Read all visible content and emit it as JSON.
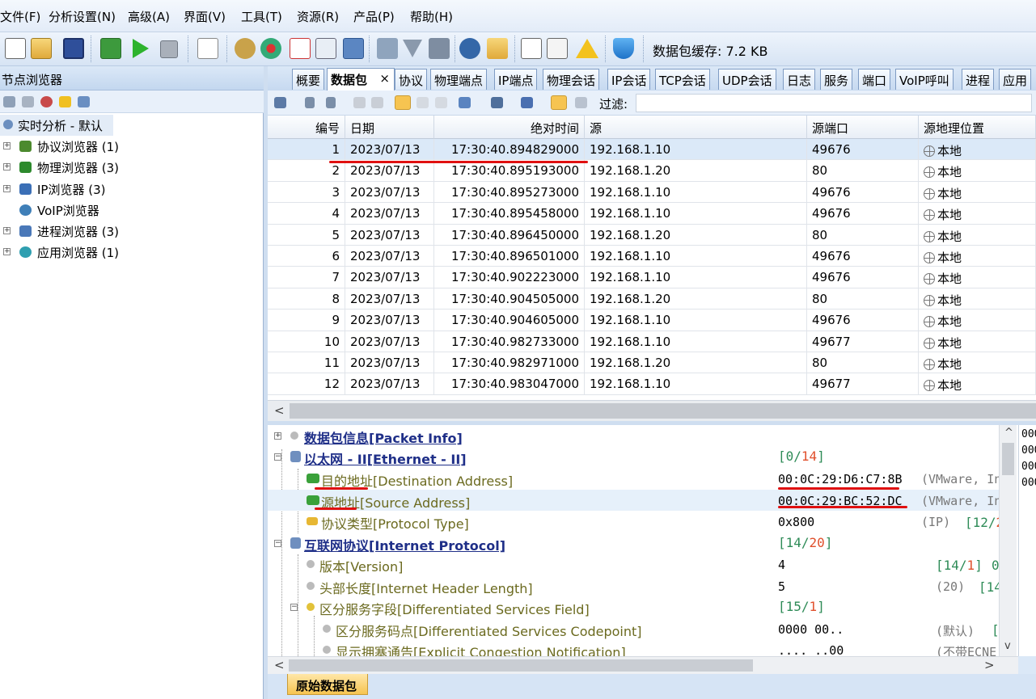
{
  "menu": [
    "文件(F)",
    "分析设置(N)",
    "高级(A)",
    "界面(V)",
    "工具(T)",
    "资源(R)",
    "产品(P)",
    "帮助(H)"
  ],
  "toolbar": {
    "buffer_label": "数据包缓存:",
    "buffer_value": "7.2 KB",
    "icons": [
      "new-icon",
      "open-icon",
      "save-icon",
      "adapter-icon",
      "play-icon",
      "stop-icon",
      "edit-icon",
      "settings-icon",
      "network-icon",
      "add-icon",
      "report-icon",
      "topology-icon",
      "trash-icon",
      "filter-icon",
      "lock-icon",
      "refresh-icon",
      "folder-icon",
      "notepad-icon",
      "copy-icon",
      "warning-icon",
      "shield-icon"
    ]
  },
  "left_panel": {
    "title": "节点浏览器",
    "root": "实时分析 - 默认",
    "items": [
      {
        "label": "协议浏览器 (1)",
        "color": "#4c8a2e"
      },
      {
        "label": "物理浏览器 (3)",
        "color": "#2d8a2d"
      },
      {
        "label": "IP浏览器 (3)",
        "color": "#3b6fb6"
      },
      {
        "label": "VoIP浏览器",
        "color": "#3f7fb8"
      },
      {
        "label": "进程浏览器 (3)",
        "color": "#4a78b8"
      },
      {
        "label": "应用浏览器 (1)",
        "color": "#2f9fb0"
      }
    ]
  },
  "tabs": {
    "items": [
      "概要",
      "数据包",
      "协议",
      "物理端点",
      "IP端点",
      "物理会话",
      "IP会话",
      "TCP会话",
      "UDP会话",
      "日志",
      "服务",
      "端口",
      "VoIP呼叫",
      "进程",
      "应用"
    ],
    "active": "数据包",
    "close": "×"
  },
  "packet_toolbar": {
    "filter_label": "过滤:"
  },
  "grid": {
    "headers": [
      "编号",
      "日期",
      "绝对时间",
      "源",
      "源端口",
      "源地理位置"
    ],
    "rows": [
      [
        "1",
        "2023/07/13",
        "17:30:40.894829000",
        "192.168.1.10",
        "49676",
        "本地"
      ],
      [
        "2",
        "2023/07/13",
        "17:30:40.895193000",
        "192.168.1.20",
        "80",
        "本地"
      ],
      [
        "3",
        "2023/07/13",
        "17:30:40.895273000",
        "192.168.1.10",
        "49676",
        "本地"
      ],
      [
        "4",
        "2023/07/13",
        "17:30:40.895458000",
        "192.168.1.10",
        "49676",
        "本地"
      ],
      [
        "5",
        "2023/07/13",
        "17:30:40.896450000",
        "192.168.1.20",
        "80",
        "本地"
      ],
      [
        "6",
        "2023/07/13",
        "17:30:40.896501000",
        "192.168.1.10",
        "49676",
        "本地"
      ],
      [
        "7",
        "2023/07/13",
        "17:30:40.902223000",
        "192.168.1.10",
        "49676",
        "本地"
      ],
      [
        "8",
        "2023/07/13",
        "17:30:40.904505000",
        "192.168.1.20",
        "80",
        "本地"
      ],
      [
        "9",
        "2023/07/13",
        "17:30:40.904605000",
        "192.168.1.10",
        "49676",
        "本地"
      ],
      [
        "10",
        "2023/07/13",
        "17:30:40.982733000",
        "192.168.1.10",
        "49677",
        "本地"
      ],
      [
        "11",
        "2023/07/13",
        "17:30:40.982971000",
        "192.168.1.20",
        "80",
        "本地"
      ],
      [
        "12",
        "2023/07/13",
        "17:30:40.983047000",
        "192.168.1.10",
        "49677",
        "本地"
      ]
    ],
    "scroll_left": "<"
  },
  "details": {
    "rows": [
      {
        "label": "数据包信息[Packet Info]",
        "style": "blue"
      },
      {
        "label": "以太网 - II[Ethernet - II]",
        "style": "blue",
        "range_a": "0",
        "range_b": "14"
      },
      {
        "label": "目的地址[Destination Address]",
        "style": "olive",
        "value": "00:0C:29:D6:C7:8B",
        "extra": "(VMware, In"
      },
      {
        "label": "源地址[Source Address]",
        "style": "olive",
        "value": "00:0C:29:BC:52:DC",
        "extra": "(VMware, In"
      },
      {
        "label": "协议类型[Protocol Type]",
        "style": "olive",
        "value": "0x800",
        "extra": "(IP)",
        "range_a": "12",
        "range_b": "2"
      },
      {
        "label": "互联网协议[Internet Protocol]",
        "style": "blue",
        "range_a": "14",
        "range_b": "20"
      },
      {
        "label": "版本[Version]",
        "style": "olive",
        "value": "4",
        "range_a": "14",
        "range_b": "1",
        "trail": "0"
      },
      {
        "label": "头部长度[Internet Header Length]",
        "style": "olive",
        "value": "5",
        "extra": "(20)",
        "range_a": "14"
      },
      {
        "label": "区分服务字段[Differentiated Services Field]",
        "style": "olive",
        "range_a": "15",
        "range_b": "1"
      },
      {
        "label": "区分服务码点[Differentiated Services Codepoint]",
        "style": "olive",
        "value": "0000 00..",
        "extra": "(默认)",
        "trail": "["
      },
      {
        "label": "显示拥塞通告[Explicit Congestion Notification]",
        "style": "olive",
        "value": ".... ..00",
        "extra": "(不带ECNE"
      }
    ],
    "hex_lines": [
      "000",
      "000",
      "000",
      "000"
    ],
    "up": "^",
    "down": "v",
    "left": "<",
    "right": ">"
  },
  "bottom_tab": "原始数据包",
  "colors": {
    "selected_row": "#dbe9f8",
    "annotation": "#e01010",
    "tab_highlight": "#f6c451"
  }
}
